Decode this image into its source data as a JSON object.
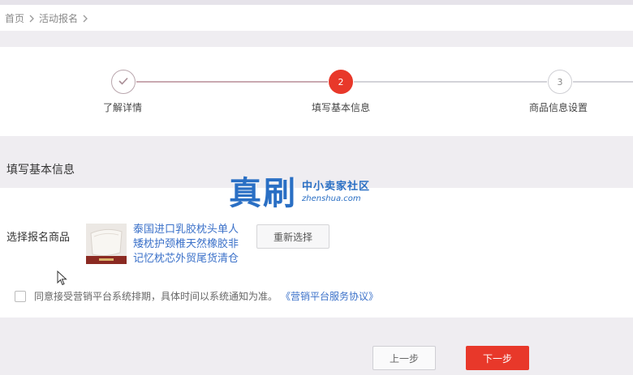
{
  "breadcrumb": {
    "items": [
      "首页",
      "活动报名"
    ]
  },
  "steps": [
    {
      "label": "了解详情",
      "number": "",
      "state": "done"
    },
    {
      "label": "填写基本信息",
      "number": "2",
      "state": "active"
    },
    {
      "label": "商品信息设置",
      "number": "3",
      "state": "todo"
    }
  ],
  "section": {
    "title": "填写基本信息"
  },
  "form": {
    "product_label": "选择报名商品",
    "product_title": "泰国进口乳胶枕头单人矮枕护颈椎天然橡胶非记忆枕芯外贸尾货清仓",
    "reselect_label": "重新选择",
    "agree_text": "同意接受营销平台系统排期，具体时间以系统通知为准。",
    "agree_link": "《营销平台服务协议》"
  },
  "footer": {
    "prev_label": "上一步",
    "next_label": "下一步"
  },
  "watermark": {
    "main": "真刷",
    "sub": "中小卖家社区",
    "domain": "zhenshua.com"
  },
  "colors": {
    "accent_red": "#e8382a",
    "link_blue": "#3b71c9",
    "watermark_blue": "#2a6fc4"
  }
}
